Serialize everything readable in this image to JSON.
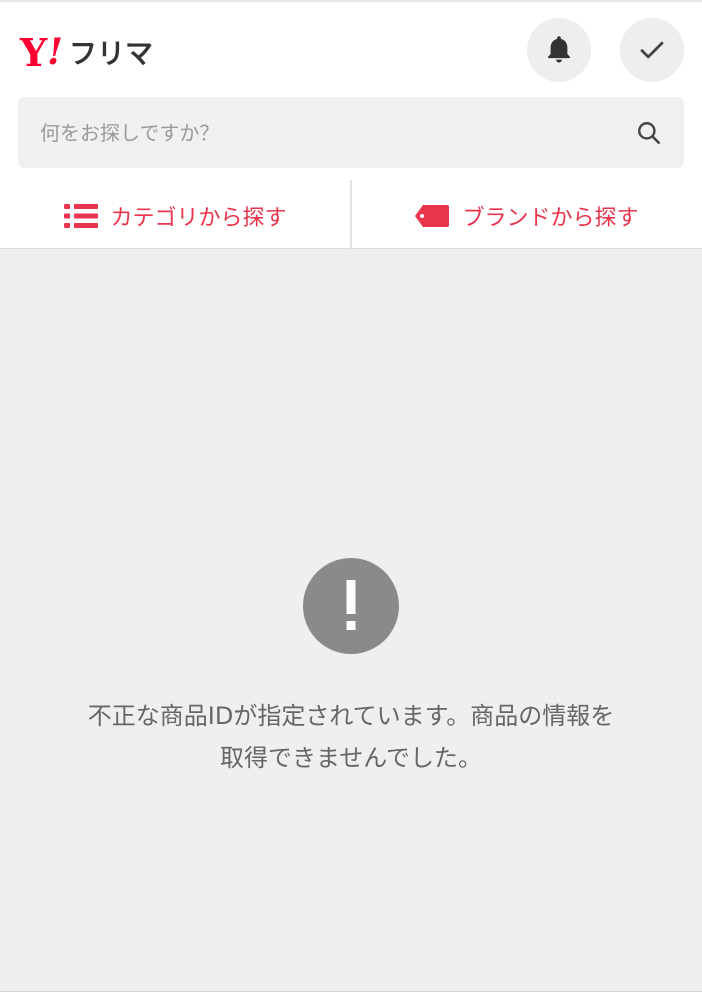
{
  "header": {
    "logo": {
      "y": "Y",
      "exclaim": "!",
      "text": "フリマ"
    },
    "notifications_icon": "bell-icon",
    "check_icon": "check-icon"
  },
  "search": {
    "placeholder": "何をお探しですか？",
    "value": "",
    "icon": "search-icon"
  },
  "nav": [
    {
      "label": "カテゴリから探す",
      "icon": "list-icon"
    },
    {
      "label": "ブランドから探す",
      "icon": "tag-icon"
    }
  ],
  "error": {
    "icon": "alert-icon",
    "line1": "不正な商品IDが指定されています。商品の情報を",
    "line2": "取得できませんでした。"
  },
  "colors": {
    "accent": "#e9344e",
    "logo_red": "#ff0033",
    "background": "#efefef",
    "alert_gray": "#8a8a8a"
  }
}
